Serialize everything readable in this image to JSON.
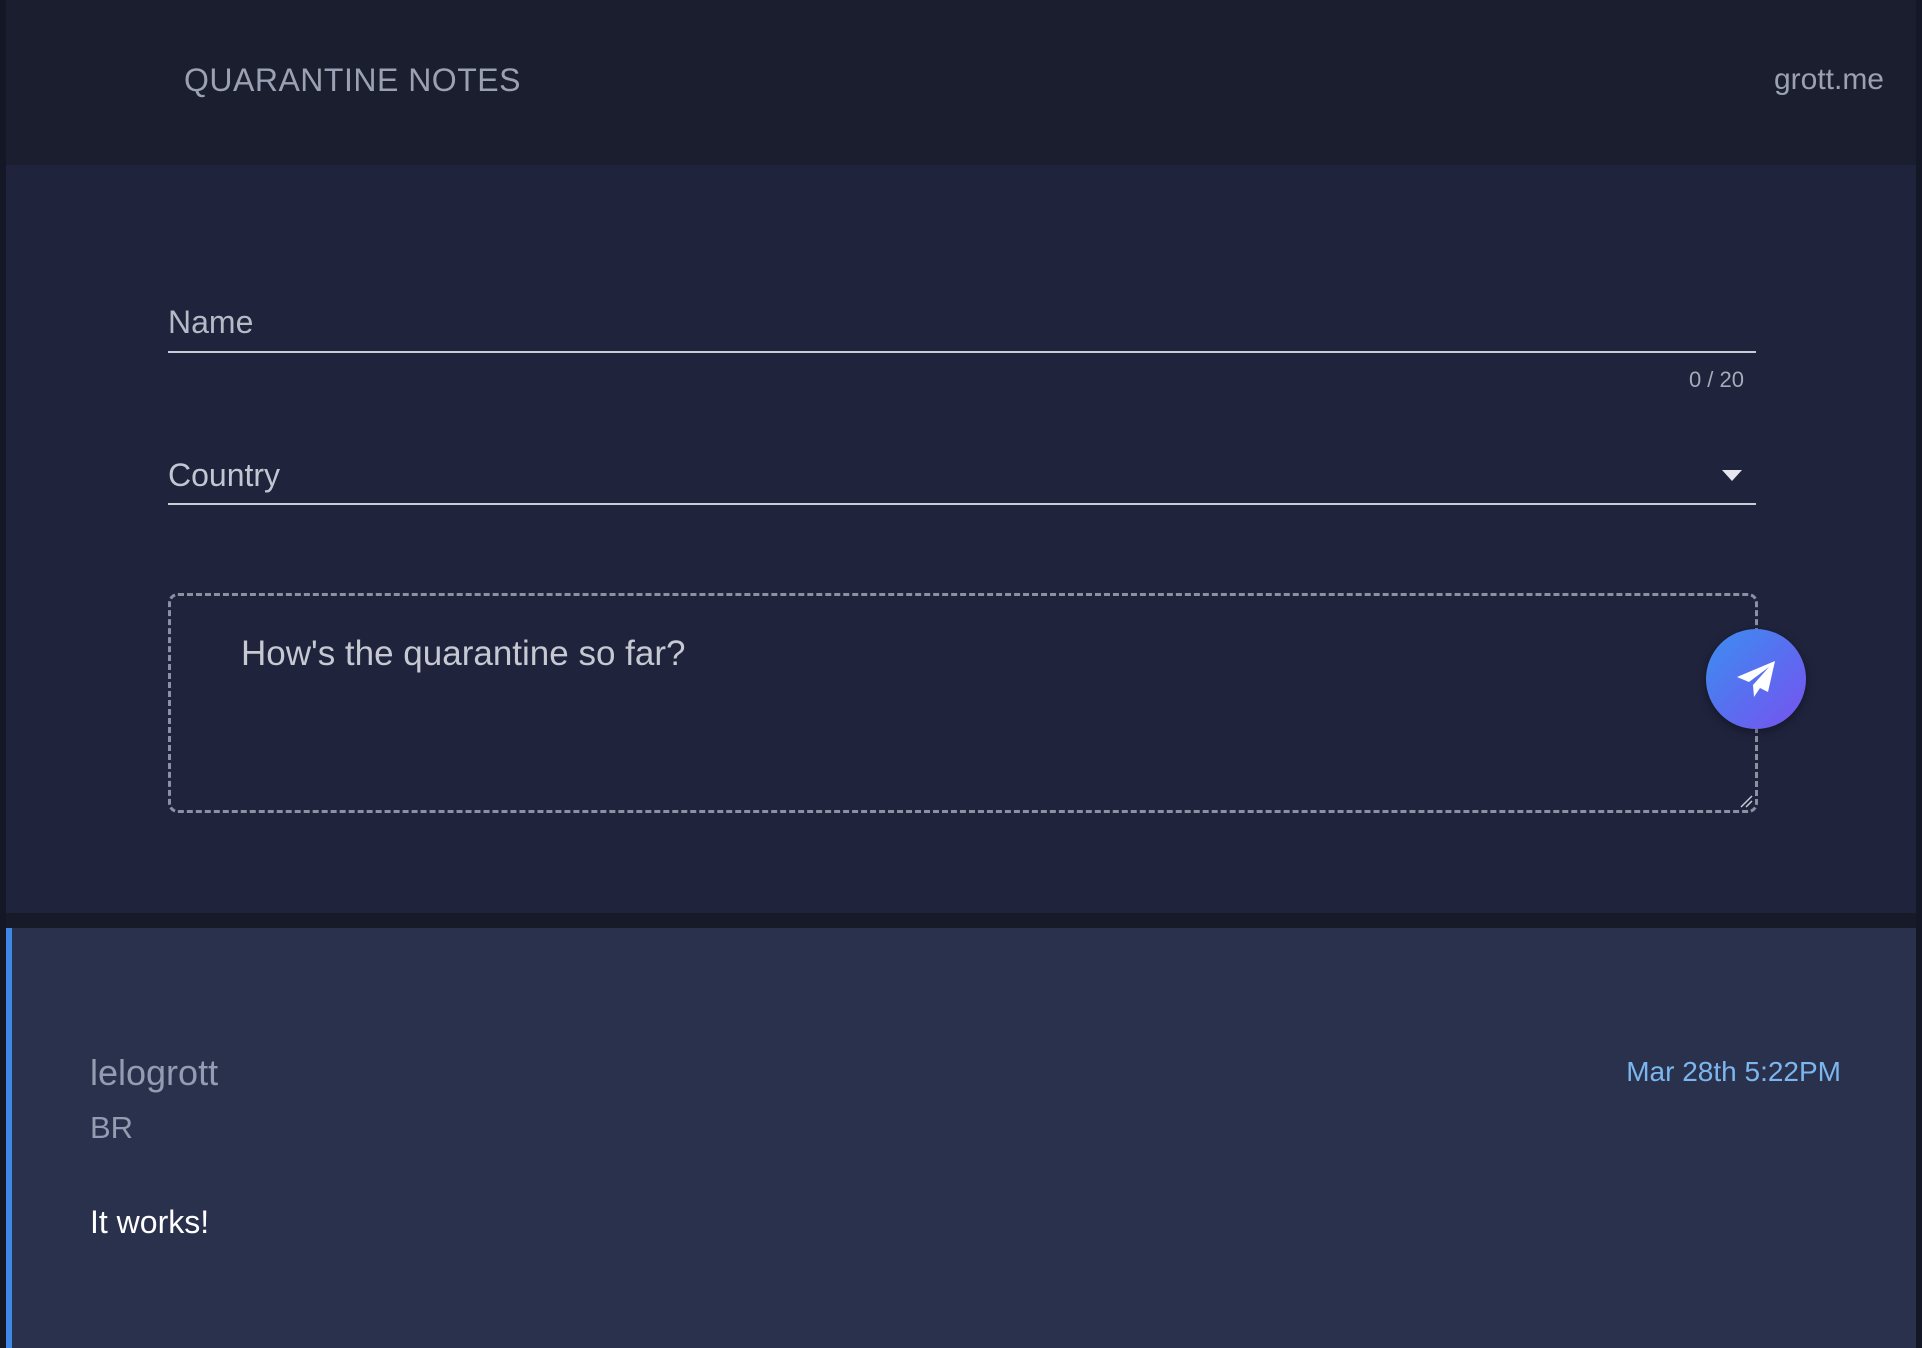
{
  "header": {
    "brand": "QUARANTINE NOTES",
    "site_link": "grott.me"
  },
  "form": {
    "name_placeholder": "Name",
    "name_value": "",
    "name_counter": "0 / 20",
    "country_label": "Country",
    "message_placeholder": "How's the quarantine so far?",
    "message_value": "",
    "send_icon": "paper-plane-icon"
  },
  "notes": [
    {
      "author": "lelogrott",
      "country": "BR",
      "timestamp": "Mar 28th 5:22PM",
      "body": "It works!"
    }
  ],
  "colors": {
    "page_bg": "#1c2032",
    "header_bg": "#1b1e2e",
    "form_bg": "#1f233c",
    "card_bg": "#2a314d",
    "card_accent": "#3f88e6",
    "timestamp": "#7cb6ef",
    "send_gradient_start": "#3b8ff0",
    "send_gradient_end": "#7852ee"
  }
}
